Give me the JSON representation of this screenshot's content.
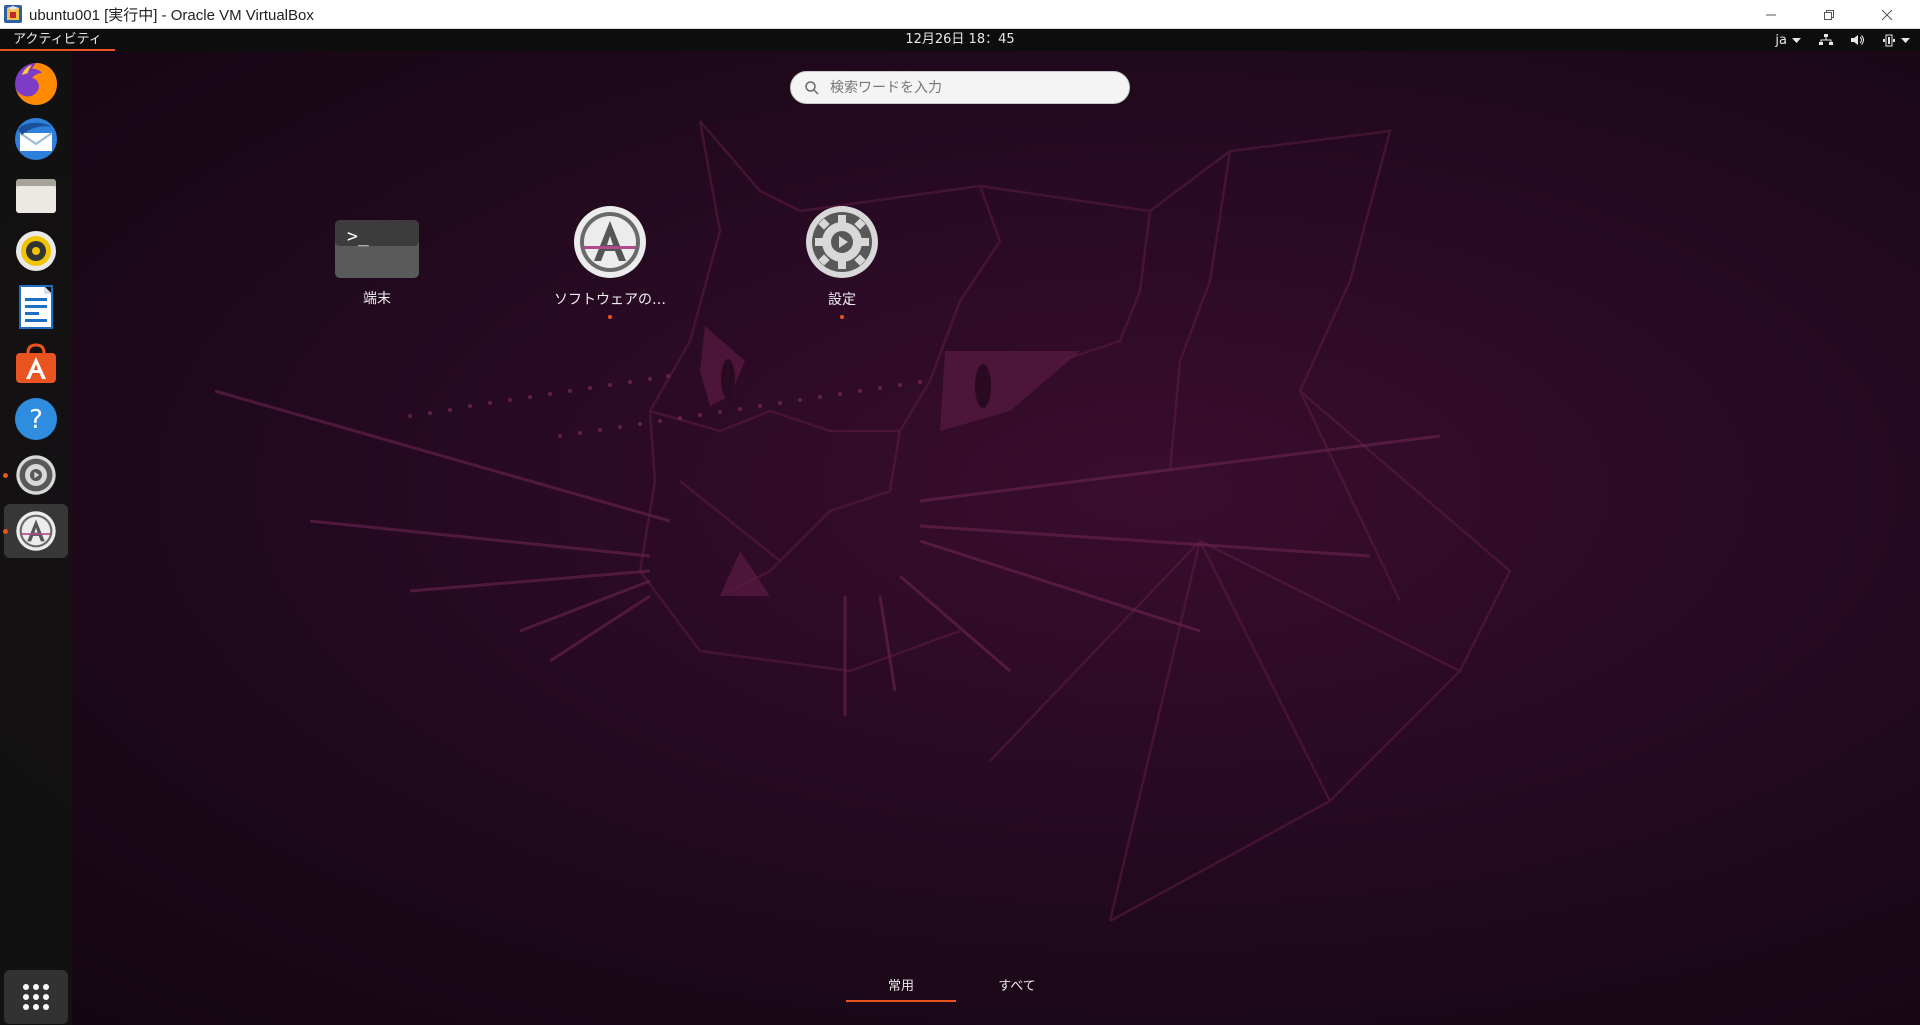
{
  "window": {
    "title": "ubuntu001 [実行中] - Oracle VM VirtualBox",
    "controls": [
      "minimize",
      "restore",
      "close"
    ]
  },
  "topbar": {
    "activities_label": "アクティビティ",
    "clock": "12月26日  18：45",
    "input_method": "ja",
    "tray_icons": [
      "network-icon",
      "volume-icon",
      "battery-icon",
      "system-menu-arrow-icon"
    ]
  },
  "search": {
    "placeholder": "検索ワードを入力",
    "value": ""
  },
  "apps": [
    {
      "name": "端末",
      "icon": "terminal-icon",
      "running": false
    },
    {
      "name": "ソフトウェアの…",
      "icon": "software-updater-icon",
      "running": true
    },
    {
      "name": "設定",
      "icon": "settings-icon",
      "running": true
    }
  ],
  "dock": {
    "items": [
      {
        "name": "Firefox",
        "icon": "firefox-icon",
        "running": false,
        "active": false
      },
      {
        "name": "Thunderbird",
        "icon": "thunderbird-icon",
        "running": false,
        "active": false
      },
      {
        "name": "Files",
        "icon": "files-icon",
        "running": false,
        "active": false
      },
      {
        "name": "Rhythmbox",
        "icon": "rhythmbox-icon",
        "running": false,
        "active": false
      },
      {
        "name": "LibreOffice Writer",
        "icon": "writer-icon",
        "running": false,
        "active": false
      },
      {
        "name": "Ubuntu Software",
        "icon": "ubuntu-software-icon",
        "running": false,
        "active": false
      },
      {
        "name": "Help",
        "icon": "help-icon",
        "running": false,
        "active": false
      },
      {
        "name": "Settings",
        "icon": "settings-icon",
        "running": true,
        "active": false
      },
      {
        "name": "Software Updater",
        "icon": "software-updater-icon",
        "running": true,
        "active": true
      }
    ],
    "show_apps_icon": "app-grid-icon"
  },
  "view_switcher": {
    "tabs": [
      {
        "label": "常用",
        "active": true
      },
      {
        "label": "すべて",
        "active": false
      }
    ]
  },
  "colors": {
    "accent": "#e95420",
    "topbar": "#0d0d0d",
    "wallpaper": "#2a0a24"
  }
}
